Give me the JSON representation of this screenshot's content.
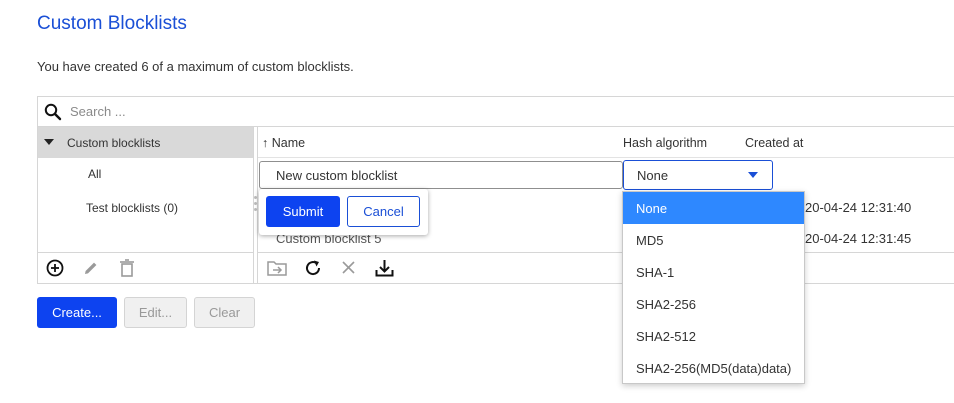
{
  "page": {
    "title": "Custom Blocklists",
    "subtitle": "You have created 6 of a maximum of custom blocklists."
  },
  "search": {
    "placeholder": "Search ..."
  },
  "tree": {
    "root_label": "Custom blocklists",
    "items": [
      {
        "label": "All"
      },
      {
        "label": "Test blocklists (0)"
      }
    ]
  },
  "table": {
    "columns": {
      "name": "Name",
      "hash": "Hash algorithm",
      "created": "Created at"
    },
    "sort_indicator": "↑",
    "new_row": {
      "name_value": "New custom blocklist",
      "hash_value": "None"
    },
    "rows": [
      {
        "name": "",
        "created": "20-04-24 12:31:40"
      },
      {
        "name": "Custom blocklist 5",
        "created": "20-04-24 12:31:45"
      }
    ]
  },
  "popover": {
    "submit_label": "Submit",
    "cancel_label": "Cancel"
  },
  "hash_dropdown": {
    "selected": "None",
    "options": [
      "None",
      "MD5",
      "SHA-1",
      "SHA2-256",
      "SHA2-512",
      "SHA2-256(MD5(data)data)"
    ]
  },
  "actions": {
    "create_label": "Create...",
    "edit_label": "Edit...",
    "clear_label": "Clear"
  },
  "icons": {
    "search": "search-icon",
    "add": "add-circle-icon",
    "edit": "pencil-icon",
    "delete": "trash-icon",
    "move": "folder-move-icon",
    "refresh": "refresh-icon",
    "close": "close-icon",
    "download": "download-icon"
  },
  "colors": {
    "accent": "#0d43f0",
    "link": "#1a4fd6",
    "selected_option": "#2e88ff",
    "tree_header_bg": "#d9d9d9"
  }
}
